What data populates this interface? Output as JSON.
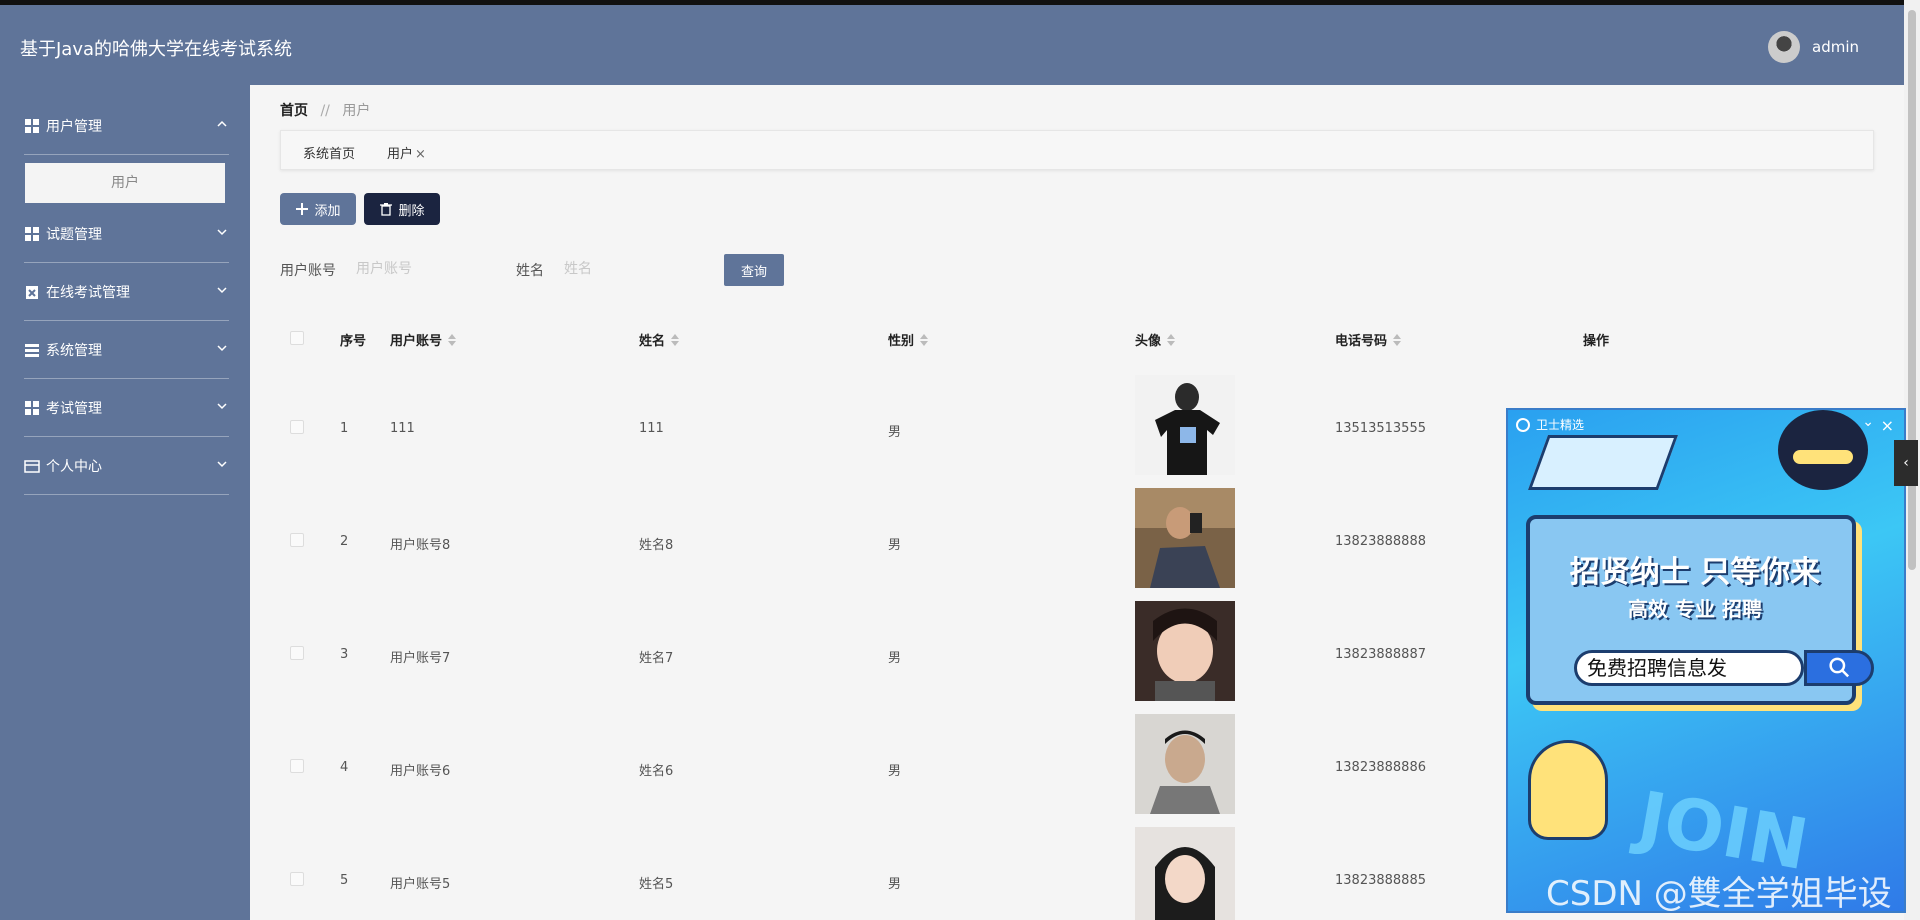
{
  "header": {
    "title": "基于Java的哈佛大学在线考试系统",
    "username": "admin"
  },
  "sidebar": {
    "items": [
      {
        "label": "用户管理",
        "icon": "grid-icon",
        "expanded": true
      },
      {
        "label": "试题管理",
        "icon": "grid-icon",
        "expanded": false
      },
      {
        "label": "在线考试管理",
        "icon": "clipboard-icon",
        "expanded": false
      },
      {
        "label": "系统管理",
        "icon": "list-icon",
        "expanded": false
      },
      {
        "label": "考试管理",
        "icon": "grid-icon",
        "expanded": false
      },
      {
        "label": "个人中心",
        "icon": "card-icon",
        "expanded": false
      }
    ],
    "sub_item": "用户"
  },
  "breadcrumb": {
    "home": "首页",
    "separator": "//",
    "current": "用户"
  },
  "tabs": [
    {
      "label": "系统首页"
    },
    {
      "label": "用户",
      "close": "×"
    }
  ],
  "toolbar": {
    "add_label": "添加",
    "delete_label": "删除"
  },
  "search": {
    "account_label": "用户账号",
    "account_placeholder": "用户账号",
    "name_label": "姓名",
    "name_placeholder": "姓名",
    "query_label": "查询"
  },
  "table": {
    "headers": [
      "序号",
      "用户账号",
      "姓名",
      "性别",
      "头像",
      "电话号码",
      "操作"
    ],
    "rows": [
      {
        "index": "1",
        "account": "111",
        "name": "111",
        "gender": "男",
        "phone": "13513513555"
      },
      {
        "index": "2",
        "account": "用户账号8",
        "name": "姓名8",
        "gender": "男",
        "phone": "13823888888"
      },
      {
        "index": "3",
        "account": "用户账号7",
        "name": "姓名7",
        "gender": "男",
        "phone": "13823888887"
      },
      {
        "index": "4",
        "account": "用户账号6",
        "name": "姓名6",
        "gender": "男",
        "phone": "13823888886"
      },
      {
        "index": "5",
        "account": "用户账号5",
        "name": "姓名5",
        "gender": "男",
        "phone": "13823888885"
      }
    ]
  },
  "ad": {
    "brand": "卫士精选",
    "headline": "招贤纳士 只等你来",
    "subline": "高效 专业 招聘",
    "search_text": "免费招聘信息发",
    "join": "JOIN",
    "close": "×",
    "minimize": "⌄",
    "handle": "‹"
  },
  "watermark": "CSDN @雙全学姐毕设",
  "colors": {
    "primary": "#5f7499",
    "dark": "#1b2440",
    "background": "#f5f5f5"
  }
}
